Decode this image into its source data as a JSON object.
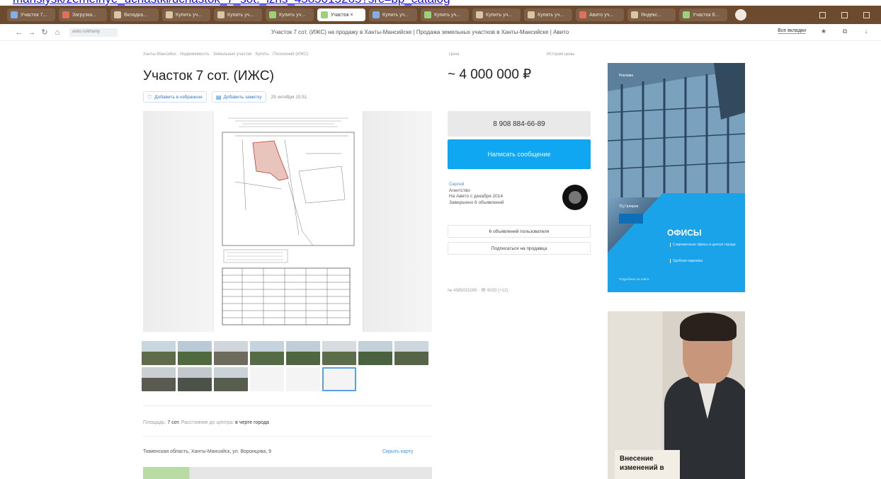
{
  "url_strip": {
    "text": "mansiysk/zemelnye_uchastki/uchastok_7_sot._izhs_4585015265?src=bp_catalog"
  },
  "browser": {
    "tabs": [
      {
        "label": "Участок 7..."
      },
      {
        "label": "Загрузка..."
      },
      {
        "label": "Вкладка..."
      },
      {
        "label": "Купить уч..."
      },
      {
        "label": "Купить уч..."
      },
      {
        "label": "Купить уч..."
      },
      {
        "label": "Участок ×",
        "active": true
      },
      {
        "label": "Купить уч..."
      },
      {
        "label": "Купить уч..."
      },
      {
        "label": "Купить уч..."
      },
      {
        "label": "Купить уч..."
      },
      {
        "label": "Авито уч..."
      },
      {
        "label": "Яндекс..."
      },
      {
        "label": "Участок 8..."
      }
    ],
    "address_chip": "avito.ru/khanty",
    "page_title": "Участок 7 сот. (ИЖС) на продажу в Ханты-Мансийске | Продажа земельных участков в Ханты-Мансийске | Авито",
    "addr_right_pill": "Все вкладки"
  },
  "listing": {
    "breadcrumb": "Ханты-Мансийск · Недвижимость · Земельные участки · Купить · Поселений (ИЖС)",
    "title": "Участок 7 сот. (ИЖС)",
    "favorite_label": "Добавить в избранное",
    "note_label": "Добавить заметку",
    "date": "25 октября 15:51",
    "area_label": "Площадь:",
    "area_value": "7 сот.",
    "distance_label": "Расстояние до центра:",
    "distance_value": "в черте города",
    "address": "Тюменская область, Ханты-Мансийск, ул. Воронцова, 9",
    "map_link": "Скрыть карту"
  },
  "sidebar": {
    "price_label": "Цена",
    "price_history": "История цены",
    "price": "~ 4 000 000 ₽",
    "phone": "8 908 884-66-89",
    "message_button": "Написать сообщение",
    "seller_name": "Сергей",
    "seller_type": "Агентство",
    "seller_since": "На Авито с декабря 2014",
    "seller_completed": "Завершено 6 объявлений",
    "all_ads_button": "6 объявлений пользователя",
    "subscribe_button": "Подписаться на продавца",
    "ad_number": "№ 4585015265 · 👁 6033 (+12)"
  },
  "ads": {
    "ad1_tag": "Реклама",
    "ad1_brand": "ТЦ Галерея",
    "ad1_title": "ОФИСЫ",
    "ad1_line1": "Современные офисы в центре города",
    "ad1_line2": "Удобная парковка",
    "ad1_small": "Подробнее на сайте",
    "ad2_text_1": "Внесение",
    "ad2_text_2": "изменений в"
  },
  "colors": {
    "tabbar": "#6b4a2e",
    "accent_blue": "#10a7f2",
    "link_blue": "#4a90d9"
  }
}
